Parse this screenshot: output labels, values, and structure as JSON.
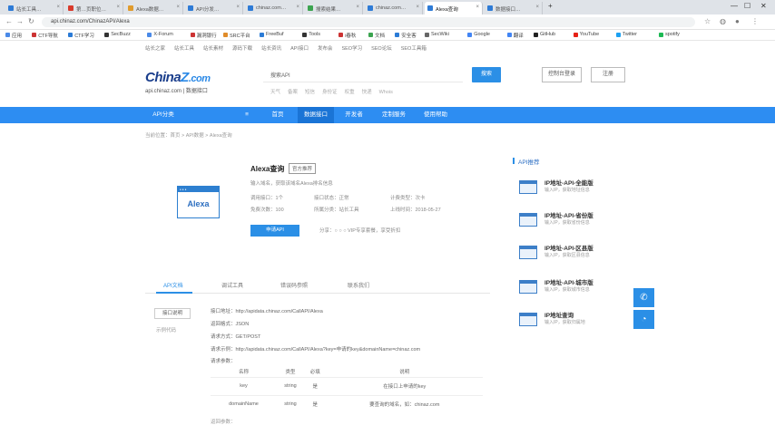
{
  "browser": {
    "tabs": [
      {
        "label": "站长工具…",
        "color": "#2e7bd6"
      },
      {
        "label": "第…页职位…",
        "color": "#d83a2b"
      },
      {
        "label": "Alexa数据…",
        "color": "#e09b2d"
      },
      {
        "label": "API分发…",
        "color": "#2e7bd6"
      },
      {
        "label": "chinaz.com…",
        "color": "#2e7bd6"
      },
      {
        "label": "搜索结果…",
        "color": "#3ca450"
      },
      {
        "label": "chinaz.com…",
        "color": "#2e7bd6"
      },
      {
        "label": "Alexa查询",
        "color": "#2e7bd6"
      },
      {
        "label": "数据接口…",
        "color": "#2e7bd6"
      }
    ],
    "url": "api.chinaz.com/ChinazAPI/Alexa",
    "bookmarks": [
      {
        "label": "应用",
        "color": "#4a8ae8"
      },
      {
        "label": "CTF导航",
        "color": "#c33"
      },
      {
        "label": "CTF学习",
        "color": "#2b7bd6"
      },
      {
        "label": "SecBuzz",
        "color": "#333"
      },
      {
        "label": "X-Forum",
        "color": "#4a8ae8"
      },
      {
        "label": "漏洞银行",
        "color": "#c33"
      },
      {
        "label": "SRC平台",
        "color": "#e08c2a"
      },
      {
        "label": "FreeBuf",
        "color": "#2b7bd6"
      },
      {
        "label": "Tools",
        "color": "#333"
      },
      {
        "label": "i春秋",
        "color": "#c33"
      },
      {
        "label": "文档",
        "color": "#3ca450"
      },
      {
        "label": "安全客",
        "color": "#2b7bd6"
      },
      {
        "label": "SecWiki",
        "color": "#666"
      },
      {
        "label": "Google",
        "color": "#4285f4"
      },
      {
        "label": "翻译",
        "color": "#4285f4"
      },
      {
        "label": "GitHub",
        "color": "#222"
      },
      {
        "label": "YouTube",
        "color": "#e62117"
      },
      {
        "label": "Twitter",
        "color": "#1da1f2"
      },
      {
        "label": "spotify",
        "color": "#1db954"
      }
    ]
  },
  "site": {
    "topnav": [
      "站长之家",
      "站长工具",
      "站长素材",
      "源码下载",
      "站长资讯",
      "API接口",
      "发布会",
      "SEO学习",
      "SEO论坛",
      "SEO工具箱"
    ],
    "logo_brand_a": "China",
    "logo_brand_z": "Z",
    "logo_brand_com": ".com",
    "logo_sub": "api.chinaz.com | 数据接口",
    "search_value": "搜索API",
    "hotwords": [
      "天气",
      "备案",
      "短信",
      "身份证",
      "权重",
      "快递",
      "Whois"
    ],
    "search_button": "搜索",
    "console_button": "控制台登录",
    "register_button": "注册",
    "nav": [
      "API分类",
      "≡",
      "首页",
      "数据接口",
      "开发者",
      "定制服务",
      "使用帮助"
    ],
    "breadcrumb": "当前位置：首页 > API数据 > Alexa查询"
  },
  "api": {
    "icon_text": "Alexa",
    "title": "Alexa查询",
    "badge": "官方推荐",
    "desc": "输入域名，获取该域名Alexa排名信息",
    "meta": [
      "调用接口：1个",
      "接口状态：正常",
      "计费类型：次卡",
      "免费次数：100",
      "所属分类：站长工具",
      "上线时间：2018-05-27"
    ],
    "apply_button": "申请API",
    "share": "分享：○ ○ ○   VIP专享套餐，享受折扣"
  },
  "sidebar": {
    "title": "API推荐",
    "items": [
      {
        "name": "IP地址-API-全能版",
        "desc": "输入IP，获取地址信息"
      },
      {
        "name": "IP地址-API-省份版",
        "desc": "输入IP，获取省份信息"
      },
      {
        "name": "IP地址-API-区县版",
        "desc": "输入IP，获取区县信息"
      },
      {
        "name": "IP地址-API-城市版",
        "desc": "输入IP，获取城市信息"
      },
      {
        "name": "IP地址查询",
        "desc": "输入IP，获取归属地"
      }
    ]
  },
  "detail": {
    "tabs": [
      "API文档",
      "调试工具",
      "错误码参照",
      "联系我们"
    ],
    "leftnav": [
      "接口说明",
      "示例代码"
    ],
    "lines": {
      "interface": "接口地址：http://apidata.chinaz.com/CallAPI/Alexa",
      "format": "返回格式：JSON",
      "method": "请求方式：GET/POST",
      "example": "请求示例：http://apidata.chinaz.com/CallAPI/Alexa?key=申请的key&domainName=chinaz.com",
      "params": "请求参数："
    },
    "table_headers": [
      "名称",
      "类型",
      "必填",
      "说明"
    ],
    "table_rows": [
      [
        "key",
        "string",
        "是",
        "在接口上申请的key"
      ],
      [
        "domainName",
        "string",
        "是",
        "要查询的域名，如：chinaz.com"
      ]
    ],
    "more": "返回参数："
  }
}
